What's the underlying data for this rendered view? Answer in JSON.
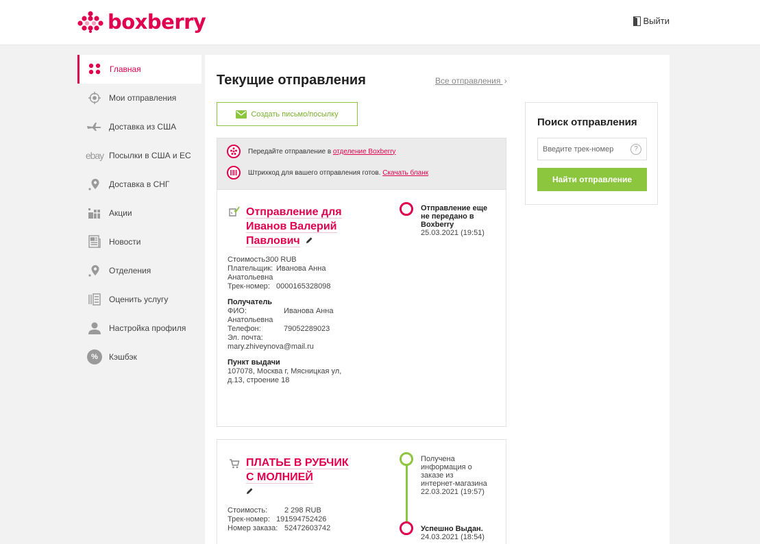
{
  "header": {
    "logo_text": "boxberry",
    "logout_label": "Выйти"
  },
  "sidebar": {
    "items": [
      {
        "label": "Главная",
        "icon": "dots-grid-icon",
        "active": true
      },
      {
        "label": "Мои отправления",
        "icon": "target-icon"
      },
      {
        "label": "Доставка из США",
        "icon": "airplane-icon"
      },
      {
        "label": "Посылки в США и ЕС",
        "icon": "ebay-logo-icon",
        "icon_text": "ebay"
      },
      {
        "label": "Доставка в СНГ",
        "icon": "map-pin-icon"
      },
      {
        "label": "Акции",
        "icon": "gifts-icon"
      },
      {
        "label": "Новости",
        "icon": "newspaper-icon"
      },
      {
        "label": "Отделения",
        "icon": "map-pin-icon"
      },
      {
        "label": "Оценить услугу",
        "icon": "rate-icon"
      },
      {
        "label": "Настройка профиля",
        "icon": "user-icon"
      },
      {
        "label": "Кэшбэк",
        "icon": "percent-icon",
        "icon_text": "%"
      }
    ]
  },
  "main": {
    "title": "Текущие отправления",
    "all_link": "Все отправления",
    "all_link_chevron": "›",
    "create_button": "Создать письмо/посылку",
    "notice": {
      "row1_text": "Передайте отправление в ",
      "row1_link": "отделение Boxberry",
      "row2_text": "Штрихкод для вашего отправления готов. ",
      "row2_link": "Скачать бланк"
    }
  },
  "shipments": [
    {
      "title_lines": [
        "Отправление для",
        "Иванов Валерий",
        "Павлович"
      ],
      "cost_label": "Стоимость:",
      "cost": "300 RUB",
      "payer_label": "Плательщик:",
      "payer_1": "Иванова Анна",
      "payer_2": "Анатольевна",
      "track_label": "Трек-номер:",
      "track": "0000165328098",
      "recipient_heading": "Получатель",
      "fio_label": "ФИО:",
      "fio_1": "Иванова Анна",
      "fio_2": "Анатольевна",
      "phone_label": "Телефон:",
      "phone": "79052289023",
      "email_label": "Эл. почта:",
      "email": "mary.zhiveynova@mail.ru",
      "pickup_heading": "Пункт выдачи",
      "pickup_1": "107078, Москва г, Мясницкая ул,",
      "pickup_2": "д.13, строение 18",
      "status_lines": [
        "Отправление еще",
        "не передано в",
        "Boxberry"
      ],
      "status_time": "25.03.2021 (19:51)",
      "status_color": "#e0004e"
    },
    {
      "title_lines": [
        "ПЛАТЬЕ В РУБЧИК",
        "С МОЛНИЕЙ"
      ],
      "cost_label": "Стоимость:",
      "cost": "2 298 RUB",
      "track_label": "Трек-номер:",
      "track": "191594752426",
      "order_label": "Номер заказа:",
      "order": "52472603742",
      "status1_lines": [
        "Получена",
        "информация о",
        "заказе из",
        "интернет-магазина"
      ],
      "status1_time": "22.03.2021 (19:57)",
      "status1_color": "#8cc63f",
      "status2_title": "Успешно Выдан.",
      "status2_time": "24.03.2021 (18:54)",
      "status2_color": "#e0004e"
    }
  ],
  "search": {
    "title": "Поиск отправления",
    "placeholder": "Введите трек-номер",
    "help": "?",
    "button": "Найти отправление"
  },
  "colors": {
    "brand": "#e0004e",
    "accent": "#8cc63f"
  }
}
